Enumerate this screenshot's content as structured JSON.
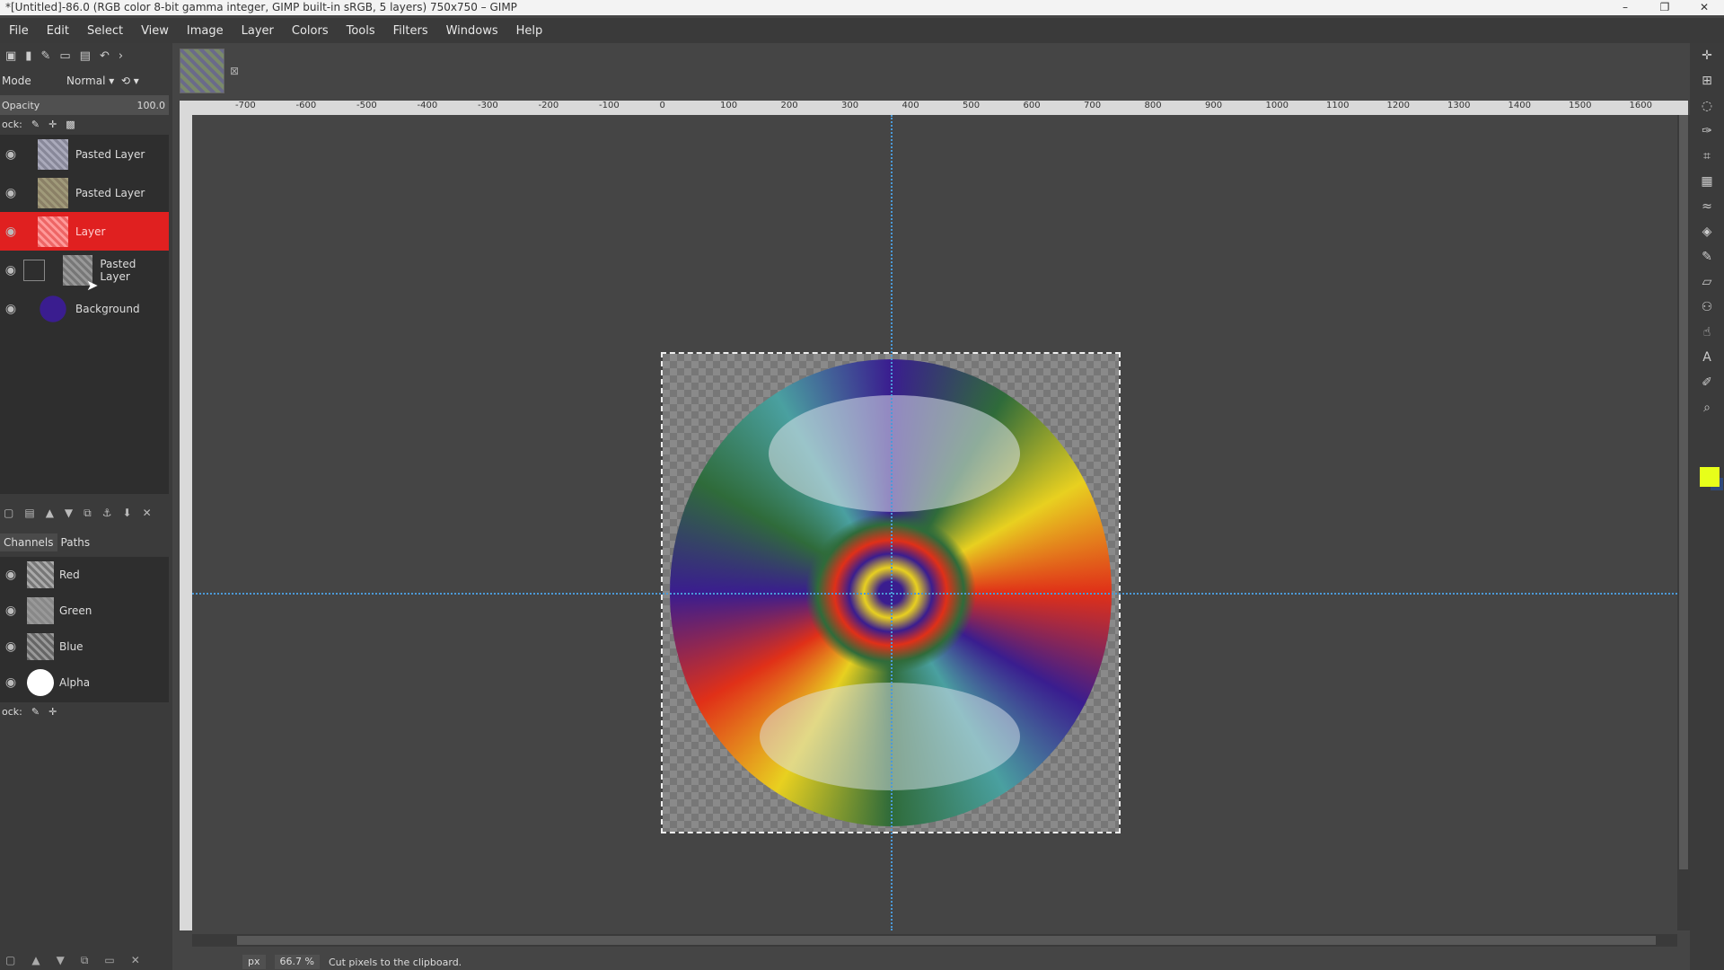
{
  "title": "*[Untitled]-86.0 (RGB color 8-bit gamma integer, GIMP built-in sRGB, 5 layers) 750x750 – GIMP",
  "window_buttons": [
    "–",
    "❐",
    "✕"
  ],
  "menu": [
    "File",
    "Edit",
    "Select",
    "View",
    "Image",
    "Layer",
    "Colors",
    "Tools",
    "Filters",
    "Windows",
    "Help"
  ],
  "layers_panel": {
    "mode_label": "Mode",
    "mode_value": "Normal",
    "opacity_label": "Opacity",
    "opacity_value": "100.0",
    "lock_label": "ock:",
    "layers": [
      {
        "name": "Pasted Layer",
        "active": false
      },
      {
        "name": "Pasted Layer",
        "active": false
      },
      {
        "name": "Layer",
        "active": true
      },
      {
        "name": "Pasted Layer",
        "active": false
      },
      {
        "name": "Background",
        "active": false
      }
    ]
  },
  "channels_panel": {
    "tabs": [
      "Channels",
      "Paths"
    ],
    "channels": [
      "Red",
      "Green",
      "Blue",
      "Alpha"
    ],
    "lock_label": "ock:"
  },
  "ruler_ticks": [
    "-700",
    "-600",
    "-500",
    "-400",
    "-300",
    "-200",
    "-100",
    "0",
    "100",
    "200",
    "300",
    "400",
    "500",
    "600",
    "700",
    "800",
    "900",
    "1000",
    "1100",
    "1200",
    "1300",
    "1400",
    "1500",
    "1600"
  ],
  "status": {
    "unit": "px",
    "zoom": "66.7 %",
    "message": "Cut pixels to the clipboard."
  },
  "colors": {
    "foreground": "#e7ff1a",
    "active_layer": "#e02020",
    "guide": "#4b9ad8"
  }
}
